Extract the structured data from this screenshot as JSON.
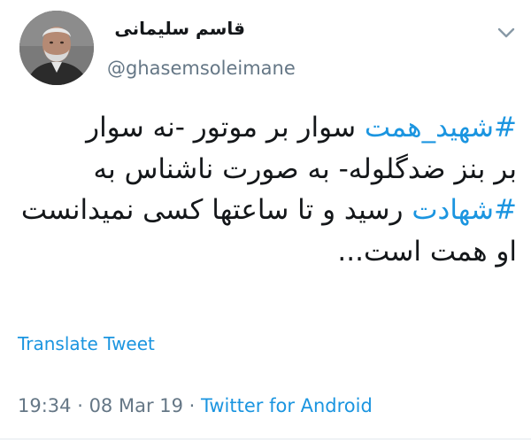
{
  "tweet": {
    "display_name": "قاسم سلیمانی",
    "handle": "@ghasemsoleimane",
    "menu_icon": "chevron-down-icon",
    "body_lines": [
      [
        {
          "text": "#شهید_همت",
          "type": "hashtag"
        },
        {
          "text": " سوار بر موتور -نه سوار",
          "type": "text"
        }
      ],
      [
        {
          "text": "بر بنز ضدگلوله- به صورت ناشناس به",
          "type": "text"
        }
      ],
      [
        {
          "text": "#شهادت",
          "type": "hashtag"
        },
        {
          "text": " رسید و تا ساعتها کسی نمیدانست",
          "type": "text"
        }
      ],
      [
        {
          "text": "او همت است...",
          "type": "text"
        }
      ]
    ],
    "translate_label": "Translate Tweet",
    "time": "19:34",
    "separator": " · ",
    "date": "08 Mar 19",
    "source": "Twitter for Android",
    "colors": {
      "link": "#1b95e0",
      "text": "#14171a",
      "muted": "#657786"
    }
  }
}
